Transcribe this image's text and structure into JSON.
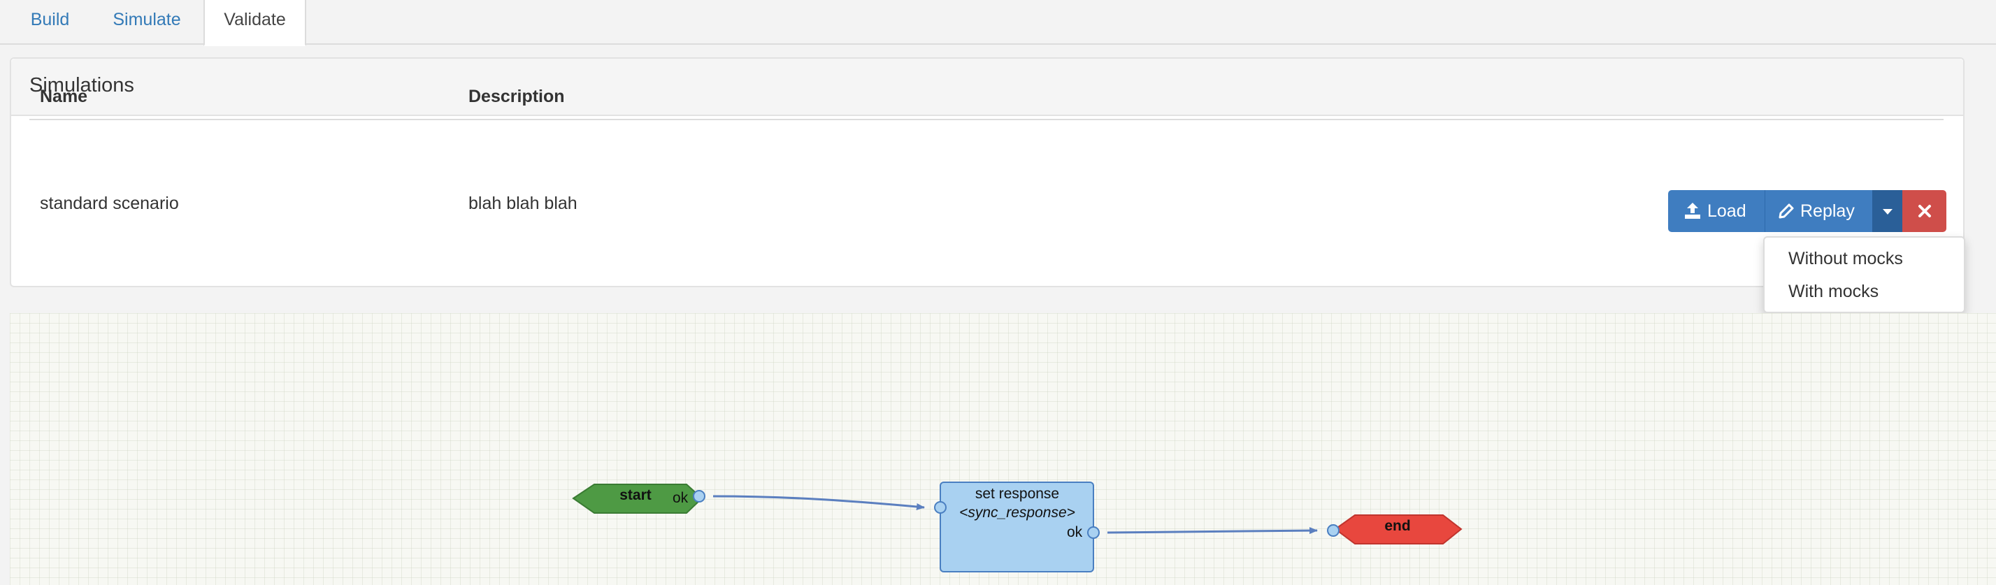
{
  "tabs": [
    {
      "label": "Build"
    },
    {
      "label": "Simulate"
    },
    {
      "label": "Validate"
    }
  ],
  "panel": {
    "title": "Simulations",
    "columns": {
      "name": "Name",
      "description": "Description"
    },
    "rows": [
      {
        "name": "standard scenario",
        "description": "blah blah blah"
      }
    ]
  },
  "actions": {
    "load_label": "Load",
    "replay_label": "Replay",
    "load_icon": "upload-icon",
    "replay_icon": "pencil-icon",
    "caret_icon": "caret-down-icon",
    "remove_icon": "close-icon"
  },
  "replay_menu": {
    "items": [
      "Without mocks",
      "With mocks"
    ]
  },
  "flow": {
    "start": {
      "label": "start",
      "port": "ok",
      "color": "#4e9a44"
    },
    "set_response": {
      "title": "set response",
      "subtitle": "<sync_response>",
      "port": "ok",
      "color": "#a9d1f1"
    },
    "end": {
      "label": "end",
      "color": "#e8473e"
    }
  },
  "colors": {
    "accent": "#337ab7",
    "danger": "#cf4e4a"
  }
}
